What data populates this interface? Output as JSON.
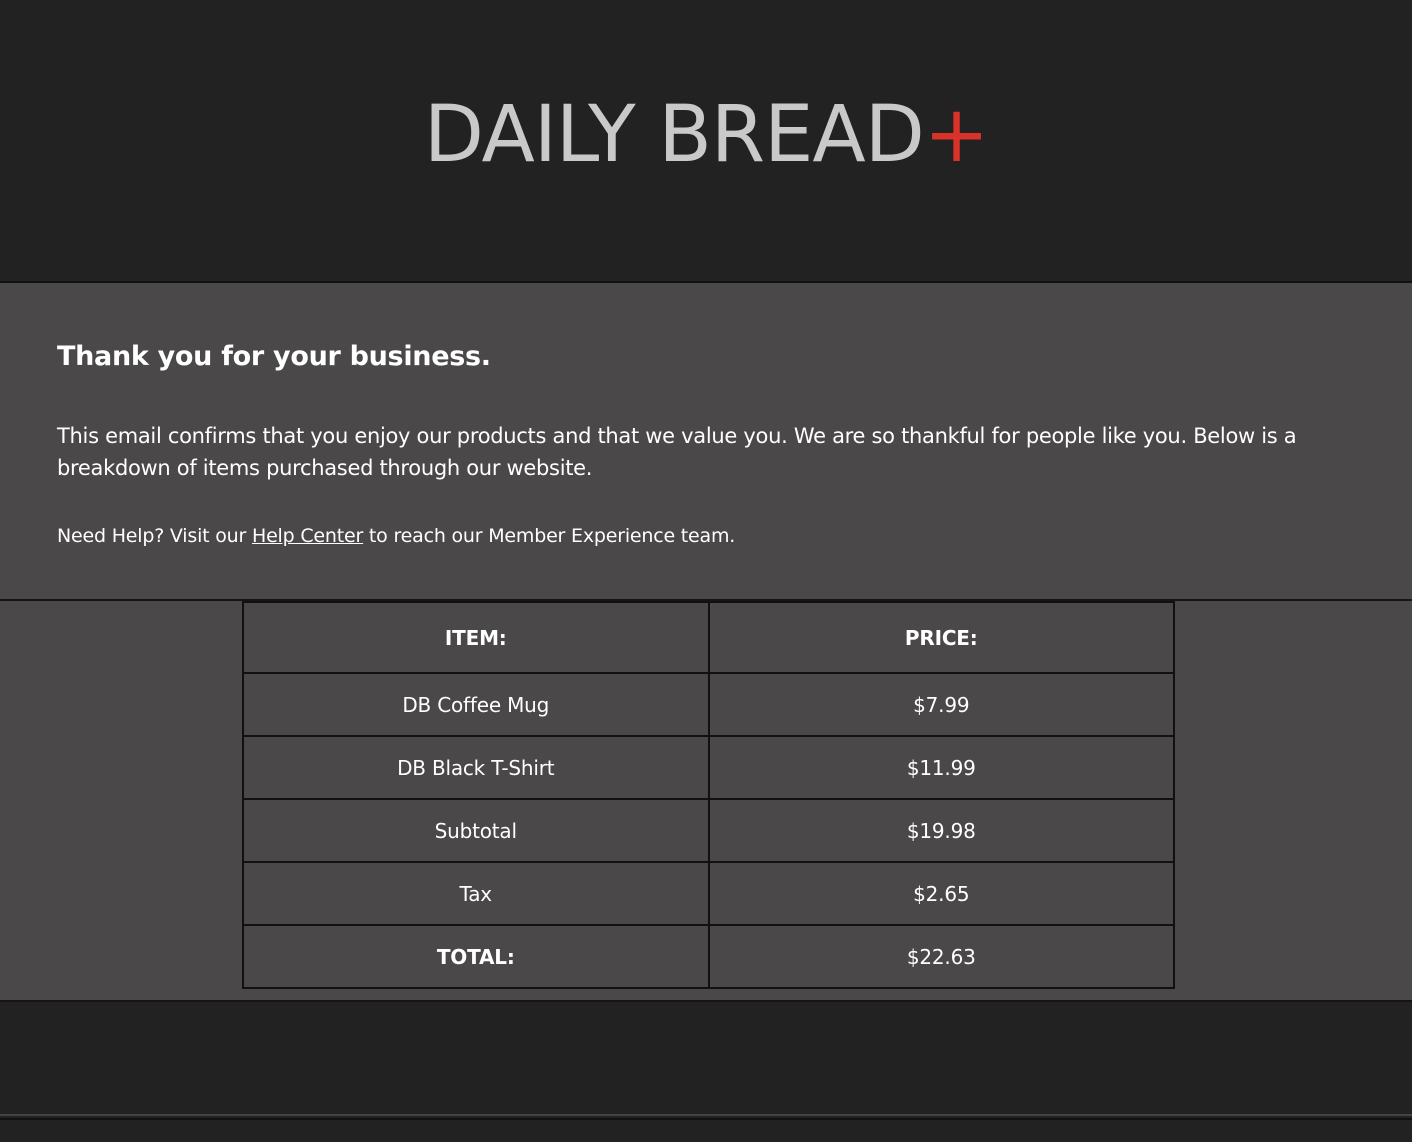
{
  "header": {
    "brand_name": "DAILY BREAD",
    "brand_suffix": "+",
    "accent_color": "#d9322a"
  },
  "message": {
    "heading": "Thank you for your business.",
    "intro": "This email confirms that you enjoy our products and that we value you. We are so thankful for people like you. Below is a breakdown of items purchased through our website.",
    "help_prefix": "Need Help? Visit our ",
    "help_link": "Help Center",
    "help_suffix": " to reach our Member Experience team."
  },
  "receipt": {
    "headers": [
      "ITEM:",
      "PRICE:"
    ],
    "rows": [
      {
        "item": "DB Coffee Mug",
        "price": "$7.99"
      },
      {
        "item": "DB Black T-Shirt",
        "price": "$11.99"
      },
      {
        "item": "Subtotal",
        "price": "$19.98"
      },
      {
        "item": "Tax",
        "price": "$2.65"
      },
      {
        "item": "TOTAL:",
        "price": "$22.63"
      }
    ]
  }
}
